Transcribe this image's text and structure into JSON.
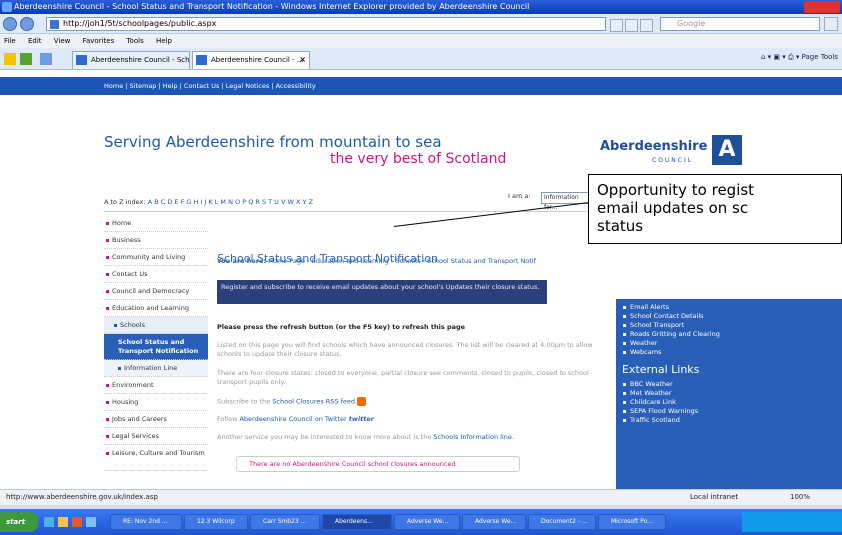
{
  "window": {
    "title": "Aberdeenshire Council - School Status and Transport Notification - Windows Internet Explorer provided by Aberdeenshire Council"
  },
  "addressbar": {
    "url": "http://joh1/5t/schoolpages/public.aspx",
    "search_placeholder": "Google"
  },
  "menu": [
    "File",
    "Edit",
    "View",
    "Favorites",
    "Tools",
    "Help"
  ],
  "tabs": [
    {
      "label": "Aberdeenshire Council - Sch..."
    },
    {
      "label": "Aberdeenshire Council - ..."
    }
  ],
  "commandbar": "Page  Tools",
  "topnav": "Home | Sitemap | Help | Contact Us | Legal Notices | Accessibility",
  "banner": {
    "slogan_line1": "Serving Aberdeenshire from mountain to sea",
    "slogan_line2": "the very best of Scotland",
    "logo_name": "Aberdeenshire",
    "logo_sub": "COUNCIL",
    "logo_mark": "A"
  },
  "az": {
    "label": "A to Z index:",
    "letters": "A B C D E F G H I J K L M N O P Q R S T U V W X Y Z",
    "iam_label": "I am a:",
    "iam_value": "Information for..."
  },
  "leftnav": [
    {
      "label": "Home",
      "type": "top"
    },
    {
      "label": "Business",
      "type": "top"
    },
    {
      "label": "Community and Living",
      "type": "top"
    },
    {
      "label": "Contact Us",
      "type": "top"
    },
    {
      "label": "Council and Democracy",
      "type": "top"
    },
    {
      "label": "Education and Learning",
      "type": "top"
    },
    {
      "label": "Schools",
      "type": "sub"
    },
    {
      "label": "School Status and Transport Notification",
      "type": "current"
    },
    {
      "label": "Information Line",
      "type": "sub2"
    },
    {
      "label": "Environment",
      "type": "top"
    },
    {
      "label": "Housing",
      "type": "top"
    },
    {
      "label": "Jobs and Careers",
      "type": "top"
    },
    {
      "label": "Legal Services",
      "type": "top"
    },
    {
      "label": "Leisure, Culture and Tourism",
      "type": "top"
    }
  ],
  "main": {
    "breadcrumb_prefix": "You are here:",
    "breadcrumb": "Home Page › Education and Learning › Schools › School Status and Transport Notif",
    "title": "School Status and Transport Notification",
    "register_link": "Register and subscribe to receive email updates about your school's Updates their closure status.",
    "refresh_note": "Please press the refresh button (or the F5 key) to refresh this page",
    "para_listed": "Listed on this page you will find schools which have announced closures. The list will be cleared at 4:00pm to allow schools to update their closure status.",
    "para_states": "There are four closure states: closed to everyone, partial closure see comments, closed to pupils, closed to school transport pupils only.",
    "rss_prefix": "Subscribe to the",
    "rss_link": "School Closures RSS feed",
    "twitter_prefix": "Follow",
    "twitter_link": "Aberdeenshire Council on Twitter",
    "twitter_logo": "twitter",
    "another_prefix": "Another service you may be interested to know more about is the",
    "another_link": "Schools Information line.",
    "no_closures": "There are no Aberdeenshire Council school closures announced"
  },
  "rightcol": {
    "links": [
      "Email Alerts",
      "School Contact Details",
      "School Transport",
      "Roads Gritting and Clearing",
      "Weather",
      "Webcams"
    ],
    "external_heading": "External Links",
    "external_links": [
      "BBC Weather",
      "Met Weather",
      "Childcare Link",
      "SEPA Flood Warnings",
      "Traffic Scotland"
    ]
  },
  "callout": {
    "line1": "Opportunity to regist",
    "line2": "email updates on sc",
    "line3": "status"
  },
  "statusbar": {
    "url": "http://www.aberdeenshire.gov.uk/index.asp",
    "zone": "Local intranet",
    "zoom": "100%"
  },
  "taskbar": {
    "start": "start",
    "items": [
      "RE: Nov 2nd ...",
      "12.3 Wilcorp",
      "Carr Smb23 ...",
      "Aberdeens...",
      "Adverse We...",
      "Adverse We...",
      "Document2 - ...",
      "Microsoft Po..."
    ]
  }
}
